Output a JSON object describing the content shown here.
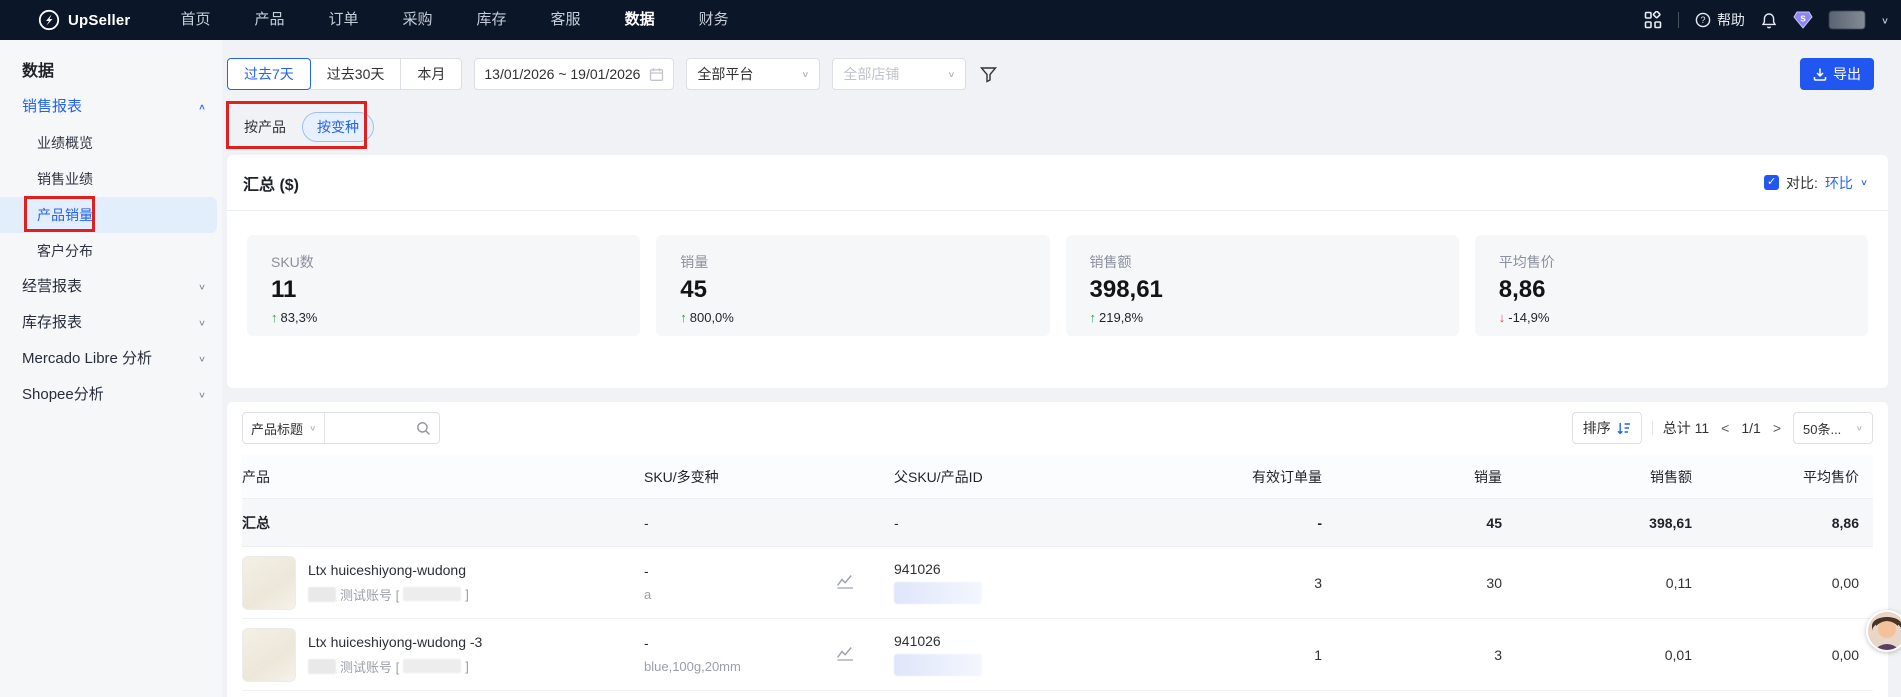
{
  "colors": {
    "accent": "#2463f2",
    "navbar_bg": "#0b1628",
    "up": "#22a94e",
    "down": "#e5484d",
    "annotation_red": "#e01f1f"
  },
  "icons": {
    "chevron_up": "∧",
    "chevron_down": "∨",
    "arrow_up": "↑",
    "arrow_down": "↓",
    "page_prev": "<",
    "page_next": ">",
    "check": "✓"
  },
  "navbar": {
    "brand": "UpSeller",
    "items": [
      {
        "label": "首页"
      },
      {
        "label": "产品"
      },
      {
        "label": "订单"
      },
      {
        "label": "采购"
      },
      {
        "label": "库存"
      },
      {
        "label": "客服"
      },
      {
        "label": "数据"
      },
      {
        "label": "财务"
      }
    ],
    "active_item": "数据",
    "help_label": "帮助"
  },
  "sidebar": {
    "title": "数据",
    "groups": [
      {
        "label": "销售报表",
        "expanded": true,
        "children": [
          {
            "label": "业绩概览"
          },
          {
            "label": "销售业绩"
          },
          {
            "label": "产品销量",
            "active": true
          },
          {
            "label": "客户分布"
          }
        ]
      },
      {
        "label": "经营报表",
        "expanded": false
      },
      {
        "label": "库存报表",
        "expanded": false
      },
      {
        "label": "Mercado Libre 分析",
        "expanded": false
      },
      {
        "label": "Shopee分析",
        "expanded": false
      }
    ]
  },
  "filters": {
    "quick_ranges": [
      {
        "label": "过去7天"
      },
      {
        "label": "过去30天"
      },
      {
        "label": "本月"
      }
    ],
    "active_range": "过去7天",
    "date_range": "13/01/2026 ~ 19/01/2026",
    "platform": "全部平台",
    "shop_placeholder": "全部店铺",
    "export_label": "导出"
  },
  "view_tabs": {
    "by_product": "按产品",
    "by_variant": "按变种",
    "active": "按变种"
  },
  "summary": {
    "title": "汇总 ($)",
    "compare_label": "对比:",
    "compare_value": "环比",
    "kpis": [
      {
        "label": "SKU数",
        "value": "11",
        "delta": "83,3%",
        "direction": "up",
        "arrow": "↑"
      },
      {
        "label": "销量",
        "value": "45",
        "delta": "800,0%",
        "direction": "up",
        "arrow": "↑"
      },
      {
        "label": "销售额",
        "value": "398,61",
        "delta": "219,8%",
        "direction": "up",
        "arrow": "↑"
      },
      {
        "label": "平均售价",
        "value": "8,86",
        "delta": "-14,9%",
        "direction": "down",
        "arrow": "↓"
      }
    ]
  },
  "table": {
    "search_field": "产品标题",
    "toolbar": {
      "sort_label": "排序",
      "total_label": "总计 11",
      "page": "1/1",
      "page_size": "50条..."
    },
    "columns": [
      "产品",
      "SKU/多变种",
      "父SKU/产品ID",
      "有效订单量",
      "销量",
      "销售额",
      "平均售价"
    ],
    "summary_row": {
      "label": "汇总",
      "sku": "-",
      "parent_id": "-",
      "orders": "-",
      "qty": "45",
      "amount": "398,61",
      "avg": "8,86"
    },
    "rows": [
      {
        "title": "Ltx huiceshiyong-wudong",
        "account_prefix": "测试账号 [",
        "account_suffix": "]",
        "sku_primary": "-",
        "sku_variant": "a",
        "parent_id": "941026",
        "orders": "3",
        "qty": "30",
        "amount": "0,11",
        "avg": "0,00"
      },
      {
        "title": "Ltx huiceshiyong-wudong -3",
        "account_prefix": "测试账号 [",
        "account_suffix": "]",
        "sku_primary": "-",
        "sku_variant": "blue,100g,20mm",
        "parent_id": "941026",
        "orders": "1",
        "qty": "3",
        "amount": "0,01",
        "avg": "0,00"
      }
    ]
  }
}
